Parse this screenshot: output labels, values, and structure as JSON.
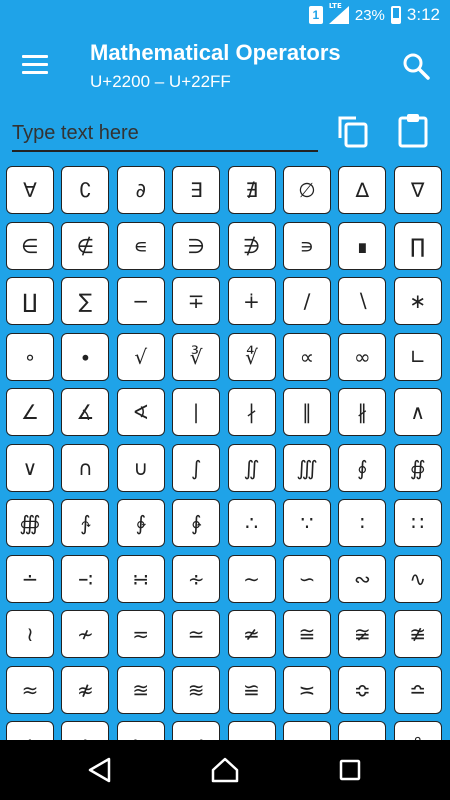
{
  "status_bar": {
    "sim": "1",
    "network": "LTE",
    "battery": "23%",
    "time": "3:12"
  },
  "appbar": {
    "title": "Mathematical Operators",
    "subtitle": "U+2200 – U+22FF"
  },
  "input": {
    "placeholder": "Type text here"
  },
  "symbols": [
    "∀",
    "∁",
    "∂",
    "∃",
    "∄",
    "∅",
    "∆",
    "∇",
    "∈",
    "∉",
    "∊",
    "∋",
    "∌",
    "∍",
    "∎",
    "∏",
    "∐",
    "∑",
    "−",
    "∓",
    "∔",
    "∕",
    "∖",
    "∗",
    "∘",
    "∙",
    "√",
    "∛",
    "∜",
    "∝",
    "∞",
    "∟",
    "∠",
    "∡",
    "∢",
    "∣",
    "∤",
    "∥",
    "∦",
    "∧",
    "∨",
    "∩",
    "∪",
    "∫",
    "∬",
    "∭",
    "∮",
    "∯",
    "∰",
    "∱",
    "∲",
    "∳",
    "∴",
    "∵",
    "∶",
    "∷",
    "∸",
    "∹",
    "∺",
    "∻",
    "∼",
    "∽",
    "∾",
    "∿",
    "≀",
    "≁",
    "≂",
    "≃",
    "≄",
    "≅",
    "≆",
    "≇",
    "≈",
    "≉",
    "≊",
    "≋",
    "≌",
    "≍",
    "≎",
    "≏",
    "≐",
    "≑",
    "≒",
    "≓",
    "≔",
    "≕",
    "≖",
    "≗"
  ]
}
